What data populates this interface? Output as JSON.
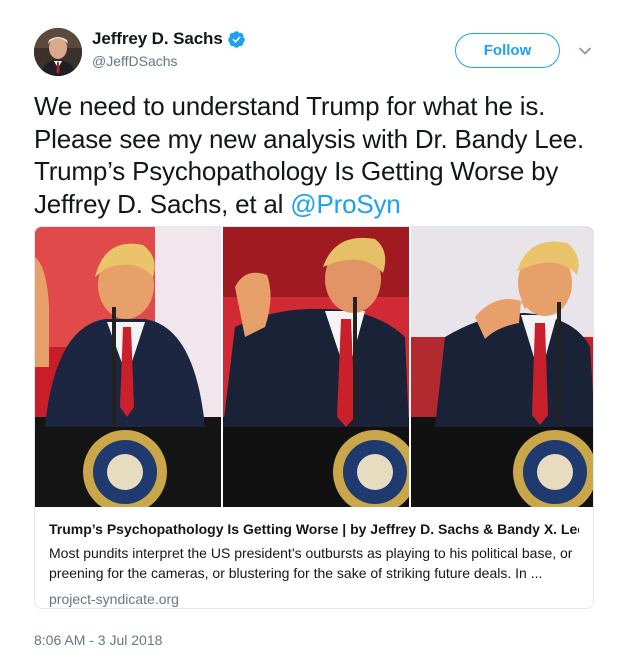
{
  "author": {
    "name": "Jeffrey D. Sachs",
    "handle": "@JeffDSachs",
    "verified_icon": "verified-badge-icon",
    "avatar_icon": "avatar"
  },
  "actions": {
    "follow_label": "Follow",
    "more_icon": "chevron-down-icon"
  },
  "tweet": {
    "text_before_link": "We need to understand Trump for what he is. Please see my new analysis with Dr. Bandy Lee. Trump’s Psychopathology Is Getting Worse by Jeffrey D. Sachs, et al ",
    "mention": "@ProSyn"
  },
  "card": {
    "image_description_icon": "card-photo",
    "title": "Trump’s Psychopathology Is Getting Worse | by Jeffrey D. Sachs & Bandy X. Lee",
    "description": "Most pundits interpret the US president’s outbursts as playing to his political base, or preening for the cameras, or blustering for the sake of striking future deals. In ...",
    "domain": "project-syndicate.org"
  },
  "timestamp": "8:06 AM - 3 Jul 2018",
  "colors": {
    "accent": "#1da1f2",
    "text_primary": "#14171a",
    "text_secondary": "#657786",
    "border": "#e1e8ed"
  }
}
